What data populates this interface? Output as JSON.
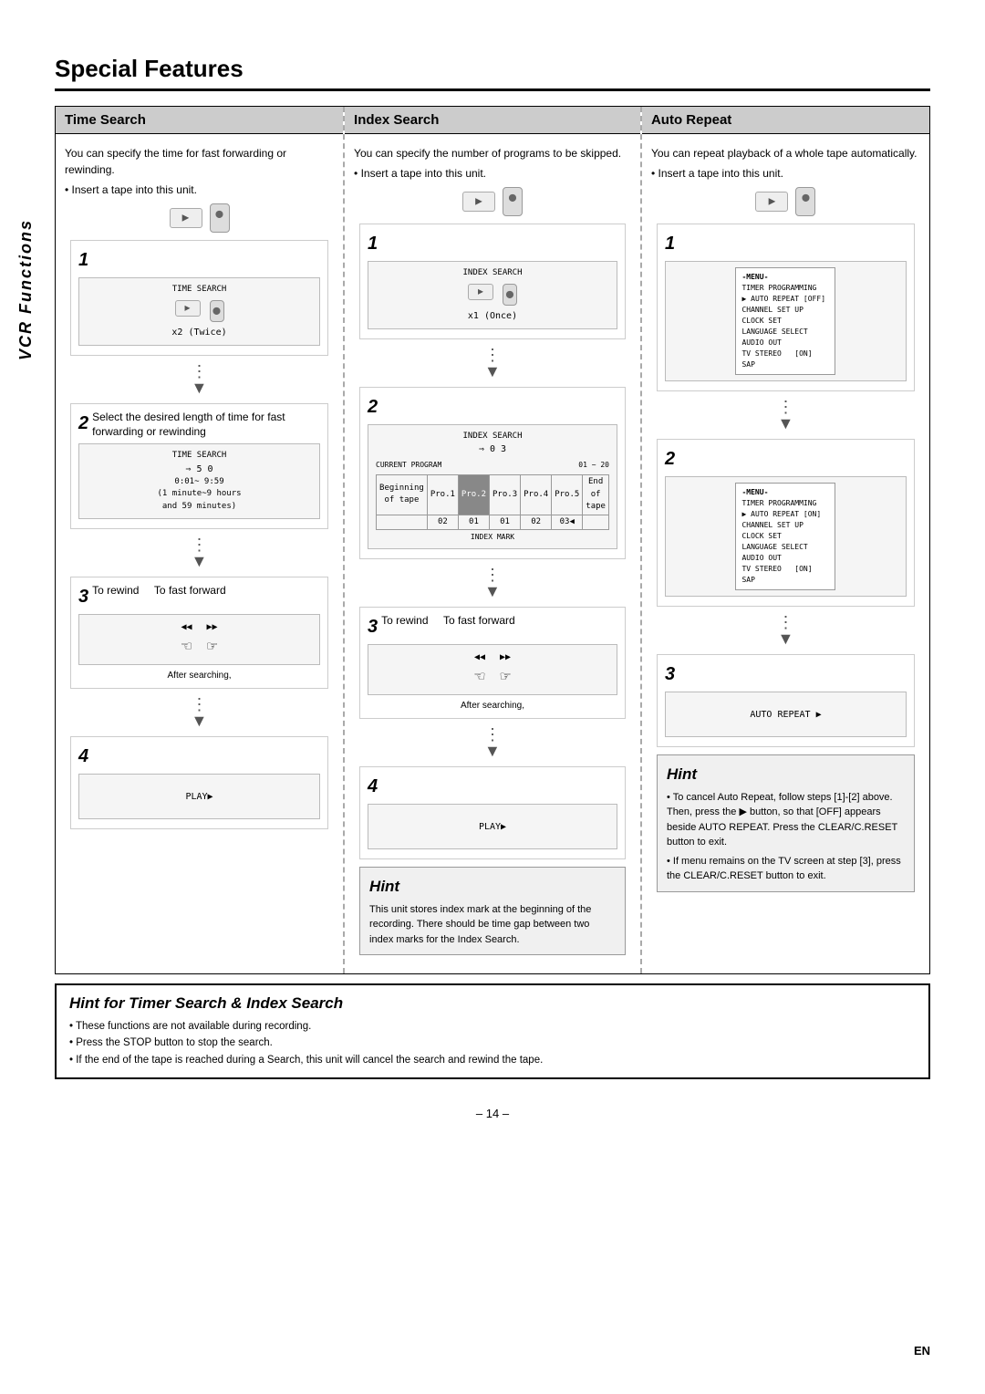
{
  "page": {
    "title": "Special Features",
    "vcr_label": "VCR Functions",
    "page_number": "– 14 –",
    "lang": "EN"
  },
  "columns": [
    {
      "id": "time-search",
      "header": "Time Search",
      "intro1": "You can specify the time for fast forwarding or rewinding.",
      "bullet": "Insert a tape into this unit.",
      "steps": [
        {
          "number": "1",
          "desc": "x2 (Twice)",
          "diagram": "TIME SEARCH\n[VCR icon] [Remote icon]\nx2 (Twice)"
        },
        {
          "number": "2",
          "desc": "Select the desired length of time for fast forwarding or rewinding",
          "diagram": "TIME SEARCH\n⇒ 5 0\n0:01~ 9:59\n(1 minute~9 hours and 59 minutes)"
        },
        {
          "number": "3",
          "sub_a": "To rewind",
          "sub_b": "To fast forward",
          "diagram": "After searching,"
        },
        {
          "number": "4",
          "diagram": "PLAY▶"
        }
      ]
    },
    {
      "id": "index-search",
      "header": "Index Search",
      "intro1": "You can specify the number of programs to be skipped.",
      "bullet": "Insert a tape into this unit.",
      "steps": [
        {
          "number": "1",
          "desc": "x1 (Once)",
          "diagram": "INDEX SEARCH\n[VCR icon] [Remote icon]\nx1 (Once)"
        },
        {
          "number": "2",
          "desc": "01 ~ 20",
          "diagram": "INDEX SEARCH\n⇒ 0 3\nCURRENT PROGRAM  01 ~ 20"
        },
        {
          "number": "3",
          "sub_a": "To rewind",
          "sub_b": "To fast forward",
          "diagram": "After searching,"
        },
        {
          "number": "4",
          "diagram": "PLAY▶"
        }
      ],
      "hint": {
        "title": "Hint",
        "text": "This unit stores index mark at the beginning of the recording. There should be time gap between two index marks for the Index Search."
      }
    },
    {
      "id": "auto-repeat",
      "header": "Auto Repeat",
      "intro1": "You can repeat playback of a whole tape automatically.",
      "bullet": "Insert a tape into this unit.",
      "steps": [
        {
          "number": "1",
          "desc": "",
          "diagram": "MENU\n-MENU-\nTIMER PROGRAMMING\n▶ AUTO REPEAT [OFF]\nCHANNEL SET UP\nCLOCK SET\nLANGUAGE SELECT\nAUDIO OUT\nTV STEREO    [ON]\nSAP"
        },
        {
          "number": "2",
          "diagram": "-MENU-\nTIMER PROGRAMMING\n▶ AUTO REPEAT [ON]\nCHANNEL SET UP\nCLOCK SET\nLANGUAGE SELECT\nAUDIO OUT\nTV STEREO    [ON]\nSAP"
        },
        {
          "number": "3",
          "diagram": "AUTO REPEAT ▶"
        }
      ],
      "hint": {
        "title": "Hint",
        "lines": [
          "To cancel Auto Repeat, follow steps [1]-[2] above. Then, press the ▶ button, so that [OFF] appears beside AUTO REPEAT. Press the CLEAR/C.RESET button to exit.",
          "If menu remains on the TV screen at step [3], press the CLEAR/C.RESET button to exit."
        ]
      }
    }
  ],
  "bottom_hint": {
    "title": "Hint for Timer Search & Index Search",
    "lines": [
      "These functions are not available during recording.",
      "Press the STOP button to stop the search.",
      "If the end of the tape is reached during a Search, this unit will cancel the search and rewind the tape."
    ]
  }
}
